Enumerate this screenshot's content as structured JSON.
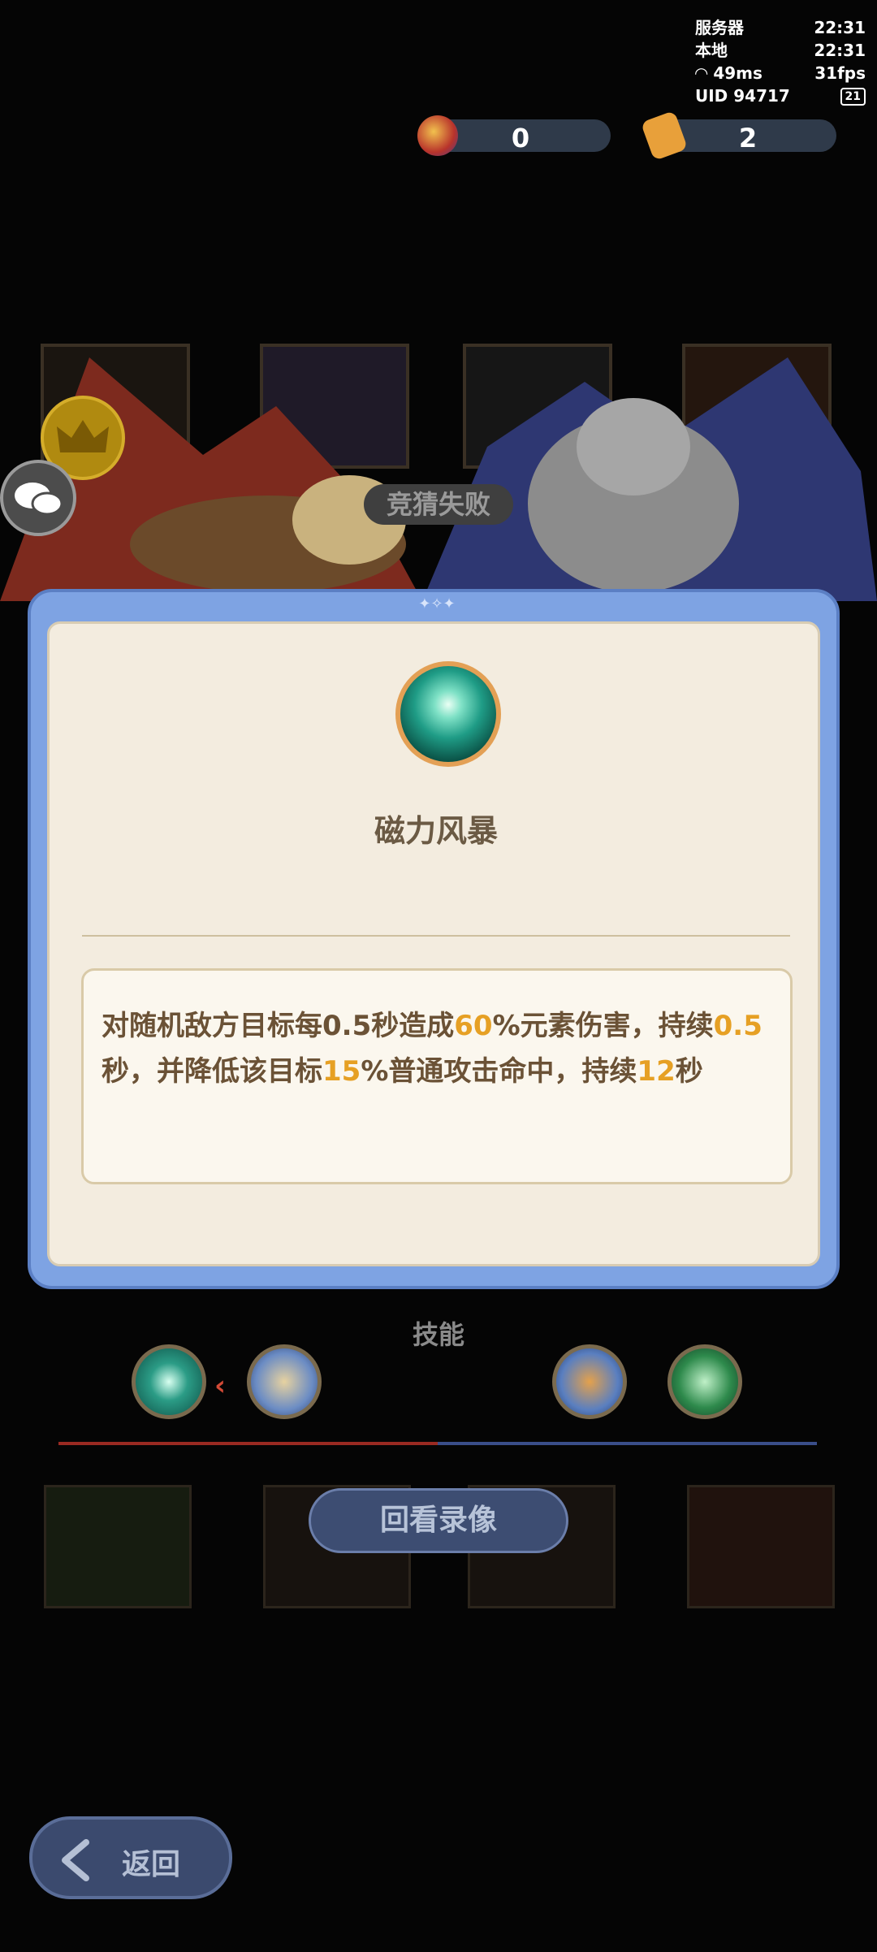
{
  "status": {
    "server_label": "服务器",
    "server_time": "22:31",
    "local_label": "本地",
    "local_time": "22:31",
    "ping": "49ms",
    "fps": "31fps",
    "uid": "UID 94717",
    "battery": "21"
  },
  "currency": {
    "gems": "0",
    "tickets": "2"
  },
  "battle": {
    "guess_result": "竞猜失败"
  },
  "skill_popup": {
    "title": "磁力风暴",
    "desc_parts": [
      {
        "text": "对随机敌方目标每0.5秒造成",
        "hl": false
      },
      {
        "text": "60",
        "hl": true
      },
      {
        "text": "%元素伤害，持续",
        "hl": false
      },
      {
        "text": "0.5",
        "hl": true
      },
      {
        "text": "秒，并降低该目标",
        "hl": false
      },
      {
        "text": "15",
        "hl": true
      },
      {
        "text": "%普通攻击命中，持续",
        "hl": false
      },
      {
        "text": "12",
        "hl": true
      },
      {
        "text": "秒",
        "hl": false
      }
    ]
  },
  "skills_label": "技能",
  "replay_button": "回看录像",
  "back_button": "返回",
  "colors": {
    "highlight": "#e6a024",
    "modal_frame": "#7ea3e3",
    "panel_bg": "#f3ecdf"
  }
}
